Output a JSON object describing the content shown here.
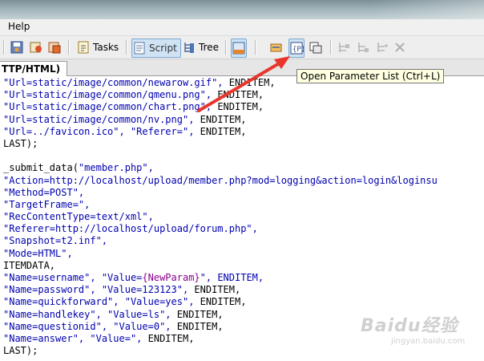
{
  "menu": {
    "help_label": "Help"
  },
  "toolbar": {
    "tasks_label": "Tasks",
    "script_label": "Script",
    "tree_label": "Tree"
  },
  "tab": {
    "label": "TTP/HTML)"
  },
  "tooltip": {
    "text": "Open Parameter List (Ctrl+L)"
  },
  "code_lines": [
    {
      "pre": "\"Url=static/image/common/newarow.gif\", ",
      "kw": "ENDITEM,",
      "param": "",
      "post": ""
    },
    {
      "pre": "\"Url=static/image/common/qmenu.png\", ",
      "kw": "ENDITEM,",
      "param": "",
      "post": ""
    },
    {
      "pre": "\"Url=static/image/common/chart.png\", ",
      "kw": "ENDITEM,",
      "param": "",
      "post": ""
    },
    {
      "pre": "\"Url=static/image/common/nv.png\", ",
      "kw": "ENDITEM,",
      "param": "",
      "post": ""
    },
    {
      "pre": "\"Url=../favicon.ico\", \"Referer=\", ",
      "kw": "ENDITEM,",
      "param": "",
      "post": ""
    },
    {
      "pre": "",
      "kw": "LAST);",
      "param": "",
      "post": ""
    },
    {
      "pre": "",
      "kw": "",
      "param": "",
      "post": ""
    },
    {
      "pre": "",
      "kw": "_submit_data(",
      "param": "",
      "post": "\"member.php\","
    },
    {
      "pre": "\"Action=http://localhost/upload/member.php?mod=logging&action=login&loginsu",
      "kw": "",
      "param": "",
      "post": ""
    },
    {
      "pre": "\"Method=POST\",",
      "kw": "",
      "param": "",
      "post": ""
    },
    {
      "pre": "\"TargetFrame=\",",
      "kw": "",
      "param": "",
      "post": ""
    },
    {
      "pre": "\"RecContentType=text/xml\",",
      "kw": "",
      "param": "",
      "post": ""
    },
    {
      "pre": "\"Referer=http://localhost/upload/forum.php\",",
      "kw": "",
      "param": "",
      "post": ""
    },
    {
      "pre": "\"Snapshot=t2.inf\",",
      "kw": "",
      "param": "",
      "post": ""
    },
    {
      "pre": "\"Mode=HTML\",",
      "kw": "",
      "param": "",
      "post": ""
    },
    {
      "pre": "",
      "kw": "ITEMDATA,",
      "param": "",
      "post": ""
    },
    {
      "pre": "\"Name=username\", \"Value=",
      "kw": "",
      "param": "{NewParam}",
      "post": "\", ENDITEM,"
    },
    {
      "pre": "\"Name=password\", \"Value=123123\", ",
      "kw": "ENDITEM,",
      "param": "",
      "post": ""
    },
    {
      "pre": "\"Name=quickforward\", \"Value=yes\", ",
      "kw": "ENDITEM,",
      "param": "",
      "post": ""
    },
    {
      "pre": "\"Name=handlekey\", \"Value=ls\", ",
      "kw": "ENDITEM,",
      "param": "",
      "post": ""
    },
    {
      "pre": "\"Name=questionid\", \"Value=0\", ",
      "kw": "ENDITEM,",
      "param": "",
      "post": ""
    },
    {
      "pre": "\"Name=answer\", \"Value=\", ",
      "kw": "ENDITEM,",
      "param": "",
      "post": ""
    },
    {
      "pre": "",
      "kw": "LAST);",
      "param": "",
      "post": ""
    }
  ],
  "watermark": {
    "brand": "Baidu经验",
    "sub": "jingyan.baidu.com"
  },
  "colors": {
    "arrow": "#e8362c",
    "string": "#0000b0",
    "param": "#8b008b"
  },
  "icons": [
    "save-icon",
    "record-icon",
    "replay-icon",
    "tasks-icon",
    "script-view-icon",
    "tree-view-icon",
    "panel-icon",
    "refresh-icon",
    "open-parameter-list-icon",
    "parameter-icon",
    "tree-a-icon",
    "tree-b-icon",
    "tree-c-icon",
    "delete-icon"
  ]
}
